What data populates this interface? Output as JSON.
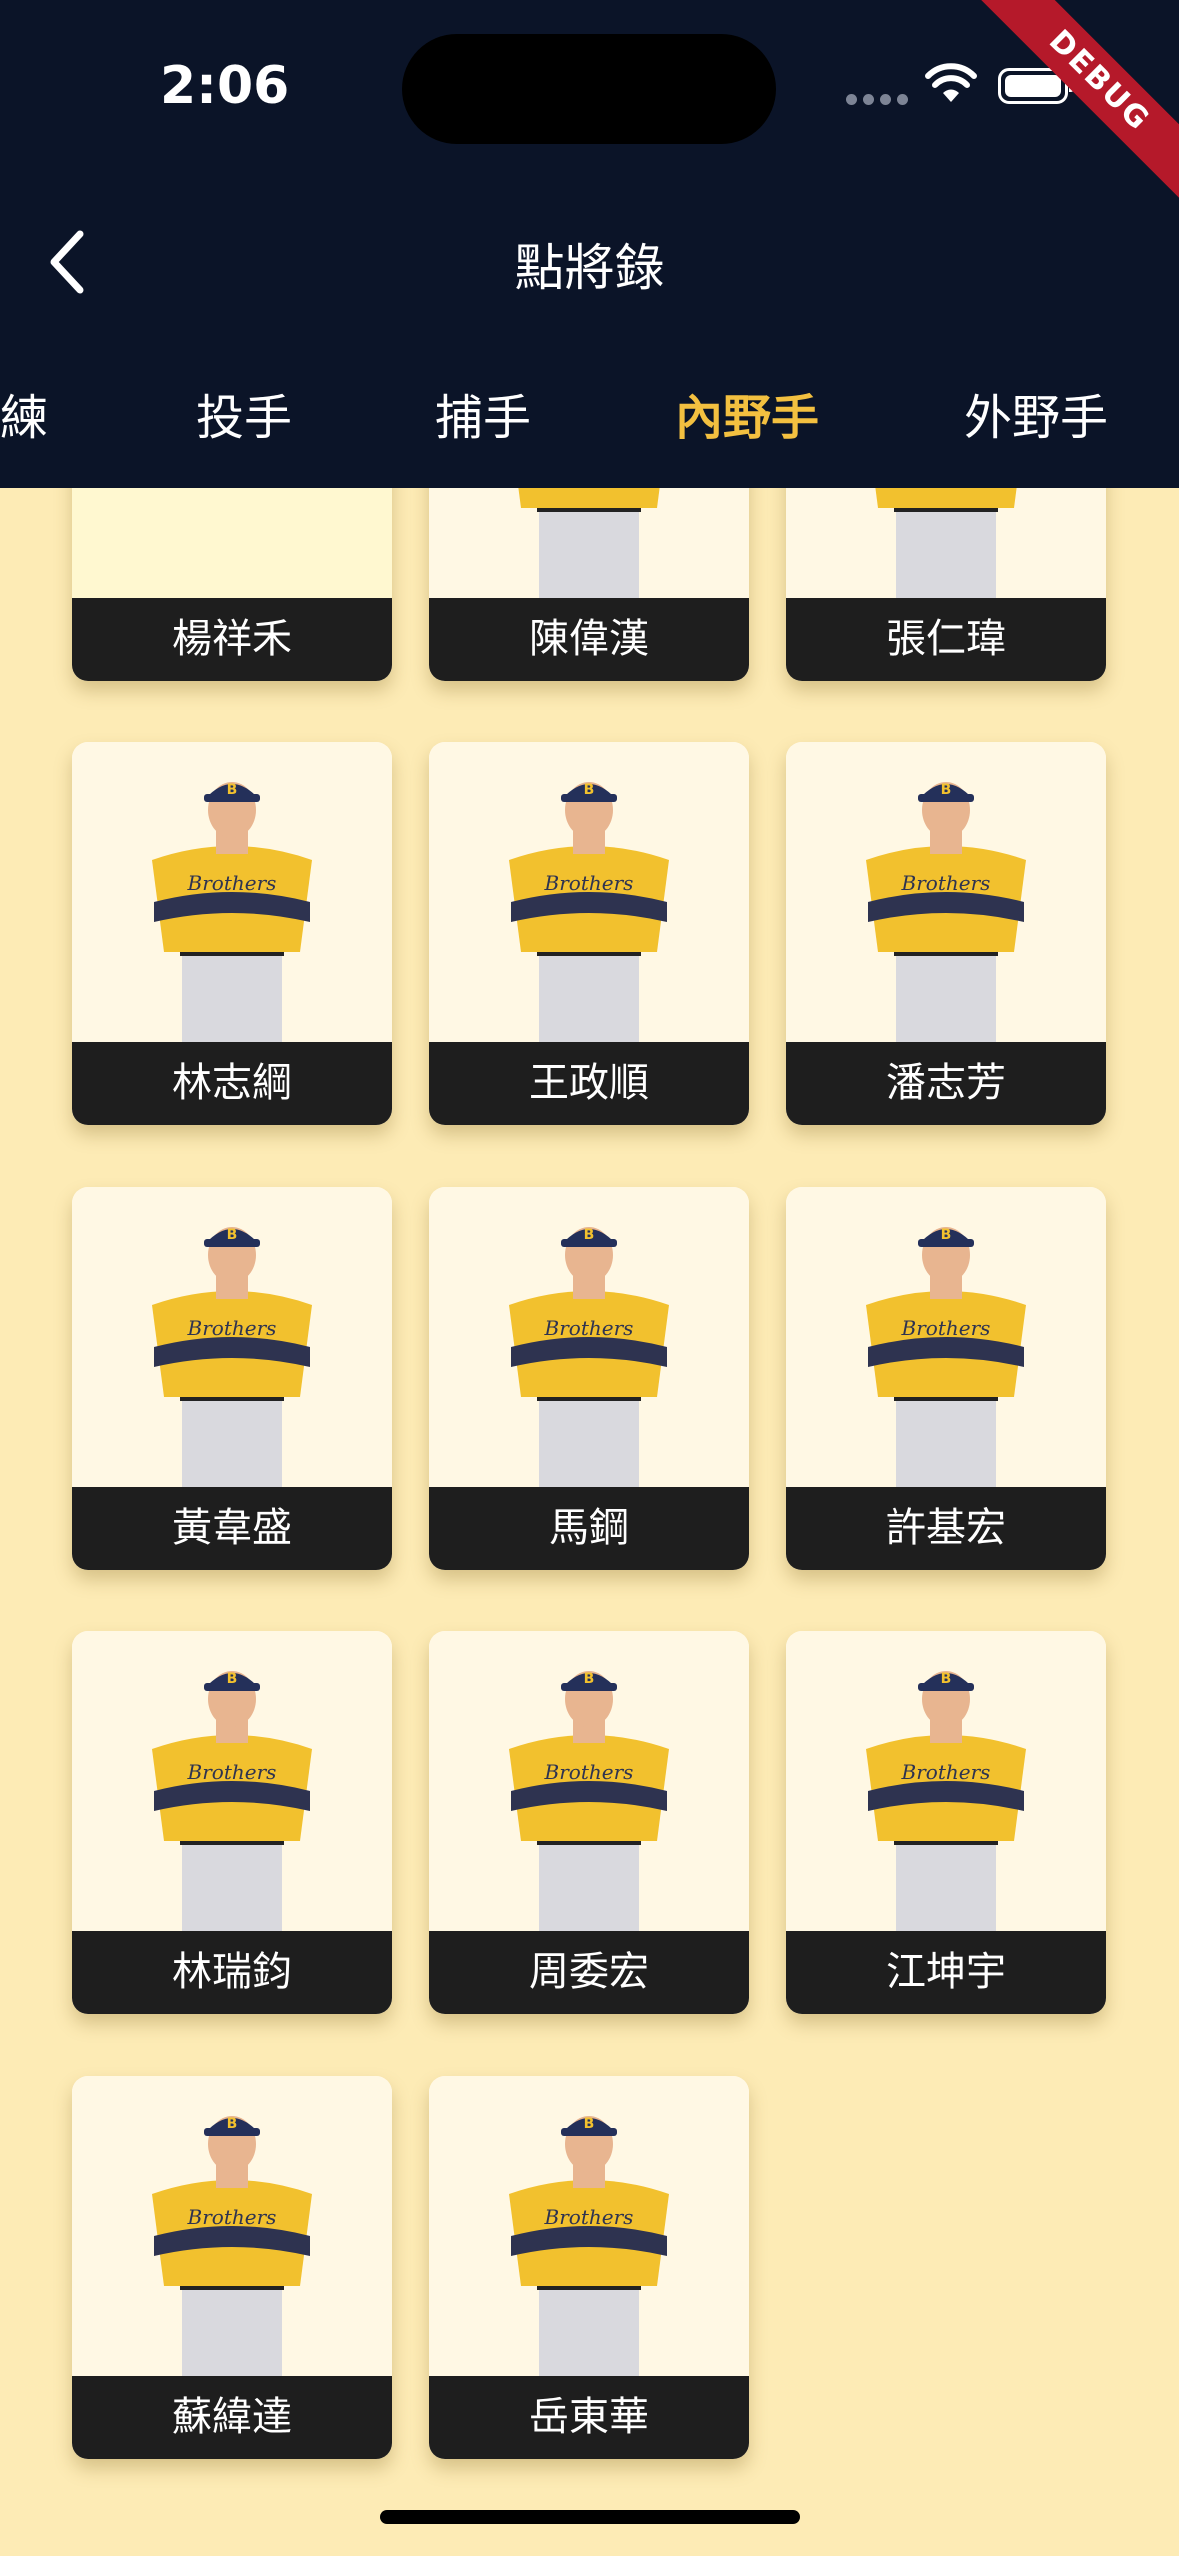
{
  "status_bar": {
    "time": "2:06",
    "debug_label": "DEBUG"
  },
  "nav": {
    "title": "點將錄"
  },
  "tabs": [
    {
      "label": "練",
      "active": false
    },
    {
      "label": "投手",
      "active": false
    },
    {
      "label": "捕手",
      "active": false
    },
    {
      "label": "內野手",
      "active": true
    },
    {
      "label": "外野手",
      "active": false
    }
  ],
  "players": [
    {
      "name": "楊祥禾"
    },
    {
      "name": "陳偉漢"
    },
    {
      "name": "張仁瑋"
    },
    {
      "name": "林志綱"
    },
    {
      "name": "王政順"
    },
    {
      "name": "潘志芳"
    },
    {
      "name": "黃韋盛"
    },
    {
      "name": "馬鋼"
    },
    {
      "name": "許基宏"
    },
    {
      "name": "林瑞鈞"
    },
    {
      "name": "周委宏"
    },
    {
      "name": "江坤宇"
    },
    {
      "name": "蘇緯達"
    },
    {
      "name": "岳東華"
    }
  ],
  "colors": {
    "header": "#0B1428",
    "background": "#FDEBB5",
    "accent": "#F3C040",
    "name_bar": "#1E1E1E"
  }
}
